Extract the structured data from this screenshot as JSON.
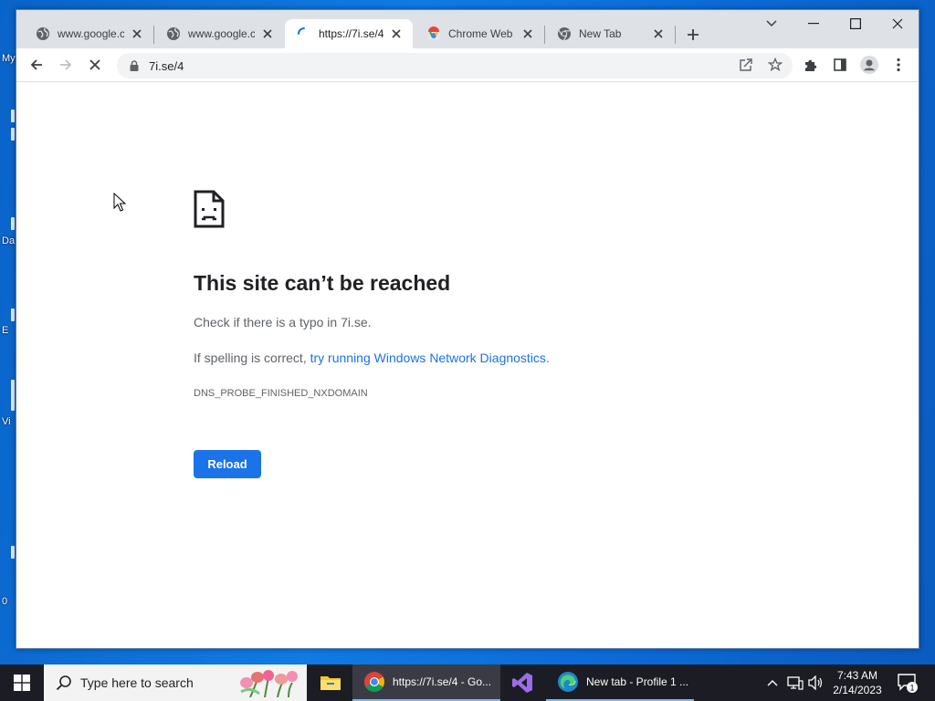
{
  "desktop": {
    "labels": [
      "My",
      "Da",
      "E",
      "Vi",
      "0"
    ]
  },
  "tabs": [
    {
      "title": "www.google.co",
      "favicon": "globe-icon"
    },
    {
      "title": "www.google.co",
      "favicon": "globe-icon"
    },
    {
      "title": "https://7i.se/4",
      "favicon": "loading-spinner-icon"
    },
    {
      "title": "Chrome Web S",
      "favicon": "chrome-web-store-icon"
    },
    {
      "title": "New Tab",
      "favicon": "chrome-icon"
    }
  ],
  "toolbar": {
    "url": "7i.se/4"
  },
  "error_page": {
    "heading": "This site can’t be reached",
    "line1": "Check if there is a typo in 7i.se.",
    "line2_prefix": "If spelling is correct, ",
    "line2_link": "try running Windows Network Diagnostics",
    "line2_suffix": ".",
    "error_code": "DNS_PROBE_FINISHED_NXDOMAIN",
    "reload_label": "Reload"
  },
  "taskbar": {
    "search_placeholder": "Type here to search",
    "apps": [
      {
        "label": "",
        "icon": "file-explorer-icon"
      },
      {
        "label": "https://7i.se/4 - Go...",
        "icon": "chrome-icon"
      },
      {
        "label": "",
        "icon": "visual-studio-icon"
      },
      {
        "label": "New tab - Profile 1 ...",
        "icon": "edge-icon"
      }
    ],
    "clock_time": "7:43 AM",
    "clock_date": "2/14/2023",
    "notification_count": "1"
  },
  "colors": {
    "accent": "#1a73e8",
    "taskbar": "#1c1c24",
    "tabstrip": "#dee1e6"
  }
}
